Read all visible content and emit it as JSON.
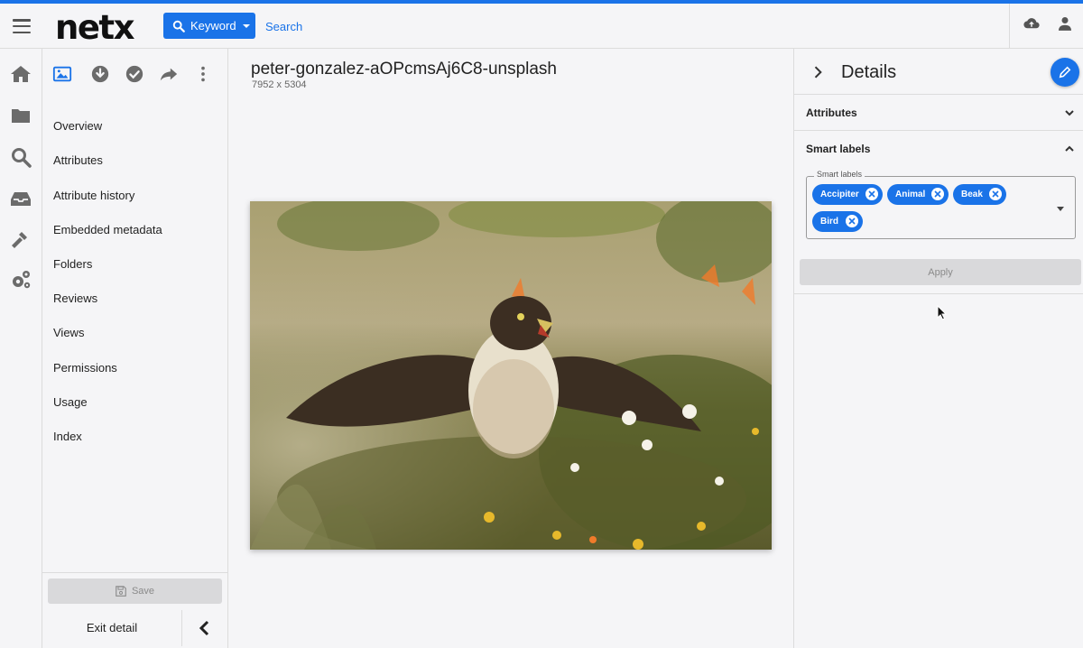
{
  "header": {
    "logo": "netx",
    "search_mode_label": "Keyword",
    "search_placeholder": "Search"
  },
  "icons": {
    "menu": "hamburger-menu-icon",
    "search_mode": "magnifier-icon",
    "upload": "cloud-upload-icon",
    "user": "user-icon",
    "nav": [
      "home-icon",
      "folder-icon",
      "search-icon",
      "inbox-icon",
      "hammer-icon",
      "gears-icon"
    ],
    "toolbar": [
      "image-icon",
      "download-icon",
      "checkmark-icon",
      "share-icon",
      "more-vertical-icon"
    ]
  },
  "menu": {
    "items": [
      "Overview",
      "Attributes",
      "Attribute history",
      "Embedded metadata",
      "Folders",
      "Reviews",
      "Views",
      "Permissions",
      "Usage",
      "Index"
    ],
    "save_label": "Save",
    "exit_label": "Exit detail"
  },
  "asset": {
    "title": "peter-gonzalez-aOPcmsAj6C8-unsplash",
    "dimensions": "7952 x 5304"
  },
  "details": {
    "title": "Details",
    "attributes_label": "Attributes",
    "smart_labels_label": "Smart labels",
    "field_legend": "Smart labels",
    "labels": [
      "Accipiter",
      "Animal",
      "Beak",
      "Bird"
    ],
    "apply_label": "Apply"
  },
  "colors": {
    "accent": "#1a73e8",
    "disabled_bg": "#d9d9db",
    "disabled_text": "#8a8a8a"
  }
}
